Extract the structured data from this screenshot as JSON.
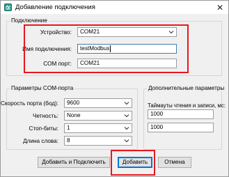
{
  "window": {
    "title": "Добавление подключения",
    "close_glyph": "✕"
  },
  "connection": {
    "legend": "Подключение",
    "device_label": "Устройство:",
    "device_value": "COM21",
    "name_label": "Имя подключения:",
    "name_value": "testModbus",
    "port_label": "COM порт:",
    "port_value": "COM21"
  },
  "com_params": {
    "legend": "Параметры COM-порта",
    "speed_label": "Скорость порта (бод):",
    "speed_value": "9600",
    "parity_label": "Четность:",
    "parity_value": "None",
    "stopbits_label": "Стоп-биты:",
    "stopbits_value": "1",
    "wordlen_label": "Длина слова:",
    "wordlen_value": "8"
  },
  "extra_params": {
    "legend": "Дополнительные параметры",
    "timeouts_label": "Таймауты чтения и записи, мс:",
    "read_timeout": "1000",
    "write_timeout": "1000"
  },
  "buttons": {
    "add_connect": "Добавить и Подключить",
    "add": "Добавить",
    "cancel": "Отмена"
  },
  "colors": {
    "highlight": "#e8171f",
    "focus_border": "#0078d7"
  }
}
